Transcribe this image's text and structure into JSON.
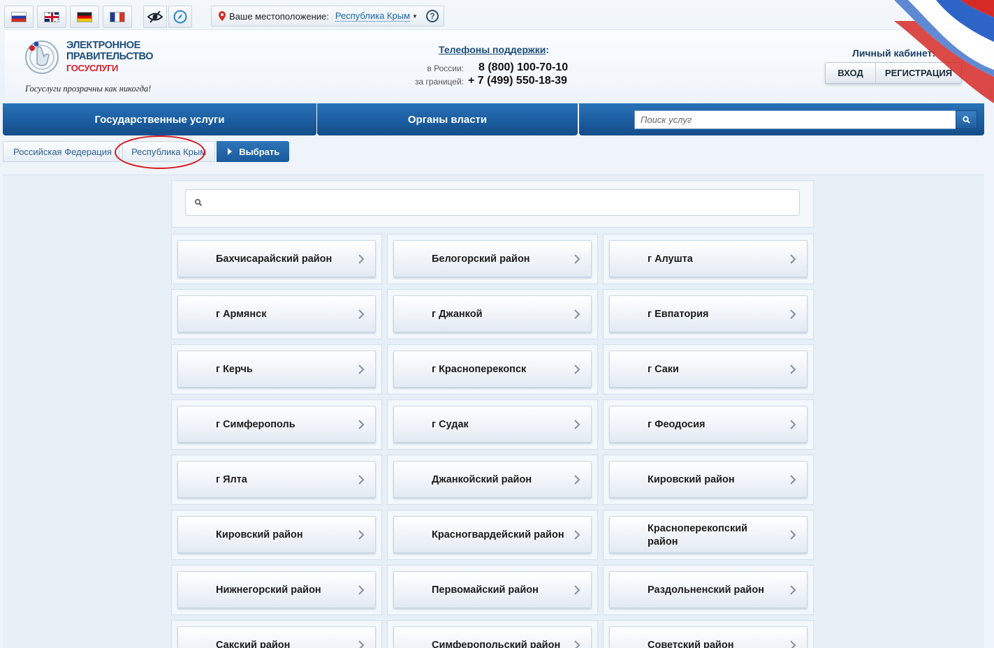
{
  "topbar": {
    "languages": [
      {
        "code": "ru",
        "icon": "flag-russia-icon"
      },
      {
        "code": "en",
        "icon": "flag-uk-icon"
      },
      {
        "code": "de",
        "icon": "flag-germany-icon"
      },
      {
        "code": "fr",
        "icon": "flag-france-icon"
      }
    ],
    "tools": [
      "low-vision-icon",
      "compass-icon"
    ],
    "location": {
      "label": "Ваше местоположение:",
      "value": "Республика Крым",
      "help": "?"
    }
  },
  "logo": {
    "line1": "ЭЛЕКТРОННОЕ",
    "line2": "ПРАВИТЕЛЬСТВО",
    "line3": "ГОСУСЛУГИ",
    "slogan": "Госуслуги прозрачны как никогда!",
    "colors": {
      "dark": "#1d4e7e",
      "red": "#d2202e"
    }
  },
  "support": {
    "title": "Телефоны поддержки",
    "suffix": ":",
    "russia_label": "в России:",
    "russia_number": "8 (800) 100-70-10",
    "abroad_label": "за границей:",
    "abroad_number": "+ 7 (499) 550-18-39"
  },
  "cabinet": {
    "title": "Личный кабинет:",
    "login": "ВХОД",
    "register": "РЕГИСТРАЦИЯ"
  },
  "nav": {
    "tabs": [
      "Государственные услуги",
      "Органы власти"
    ],
    "search_placeholder": "Поиск услуг"
  },
  "breadcrumb": {
    "items": [
      "Российская Федерация",
      "Республика Крым"
    ],
    "choose": "Выбрать",
    "highlight_color": "#d7161b"
  },
  "regions": [
    "Бахчисарайский район",
    "Белогорский район",
    "г Алушта",
    "г Армянск",
    "г Джанкой",
    "г Евпатория",
    "г Керчь",
    "г Красноперекопск",
    "г Саки",
    "г Симферополь",
    "г Судак",
    "г Феодосия",
    "г Ялта",
    "Джанкойский район",
    "Кировский район",
    "Кировский район",
    "Красногвардейский район",
    "Красноперекопский район",
    "Нижнегорский район",
    "Первомайский район",
    "Раздольненский район",
    "Сакский район",
    "Симферопольский район",
    "Советский район"
  ],
  "colors": {
    "accent": "#1b5da0",
    "link": "#1d64a8"
  }
}
